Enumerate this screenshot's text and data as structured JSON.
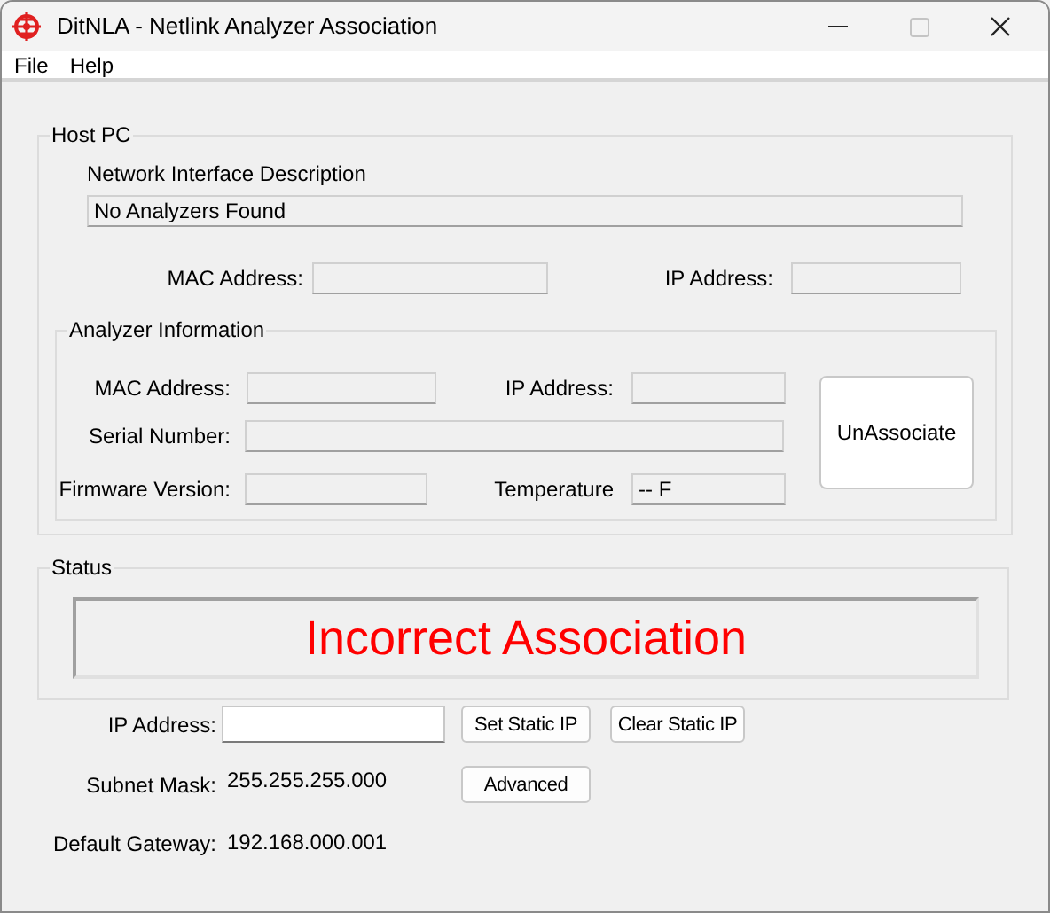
{
  "window": {
    "title": "DitNLA - Netlink Analyzer Association",
    "maximize_disabled": true
  },
  "menu": [
    {
      "label": "File"
    },
    {
      "label": "Help"
    }
  ],
  "host_pc": {
    "title": "Host PC",
    "description_label": "Network Interface Description",
    "description_value": "No Analyzers Found",
    "mac_label": "MAC Address:",
    "ip_label": "IP Address:"
  },
  "analyzer": {
    "title": "Analyzer Information",
    "fields": [
      {
        "label": "MAC Address:"
      },
      {
        "label": "IP Address:"
      },
      {
        "label": "Serial Number:"
      },
      {
        "label": "Firmware Version:"
      },
      {
        "label": "Temperature",
        "value": "-- F"
      }
    ],
    "button": "UnAssociate"
  },
  "status": {
    "title": "Status",
    "message": "Incorrect Association",
    "color": "#ff0000"
  },
  "network": {
    "ip_label": "IP Address:",
    "subnet_label": "Subnet Mask:",
    "subnet_value": "255.255.255.000",
    "gateway_label": "Default Gateway:",
    "gateway_value": "192.168.000.001",
    "buttons": [
      "Set Static IP",
      "Clear Static IP",
      "Advanced"
    ]
  }
}
